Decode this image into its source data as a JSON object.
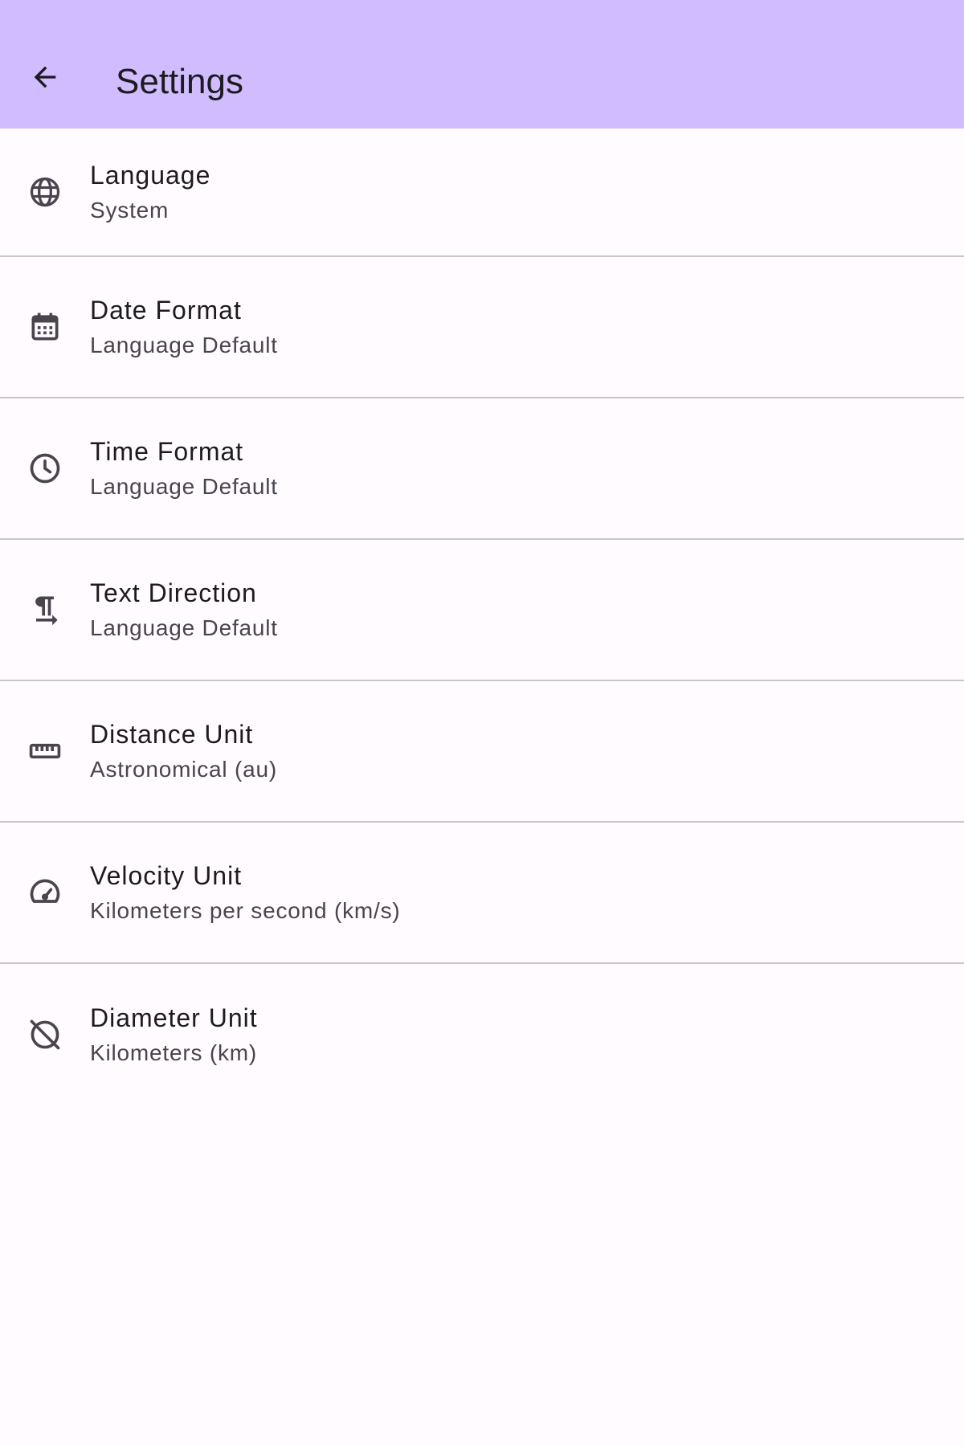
{
  "app_bar": {
    "title": "Settings",
    "back_icon": "arrow-back-icon",
    "background_color": "#d0bcff"
  },
  "settings": [
    {
      "title": "Language",
      "value": "System",
      "icon": "globe-icon"
    },
    {
      "title": "Date Format",
      "value": "Language Default",
      "icon": "calendar-icon"
    },
    {
      "title": "Time Format",
      "value": "Language Default",
      "icon": "clock-icon"
    },
    {
      "title": "Text Direction",
      "value": "Language Default",
      "icon": "text-direction-icon"
    },
    {
      "title": "Distance Unit",
      "value": "Astronomical (au)",
      "icon": "ruler-icon"
    },
    {
      "title": "Velocity Unit",
      "value": "Kilometers per second (km/s)",
      "icon": "speedometer-icon"
    },
    {
      "title": "Diameter Unit",
      "value": "Kilometers (km)",
      "icon": "diameter-off-icon"
    }
  ],
  "colors": {
    "background": "#fffbfe",
    "divider": "#c9c5ca",
    "title_text": "#1c1b1f",
    "secondary_text": "#49454f"
  }
}
